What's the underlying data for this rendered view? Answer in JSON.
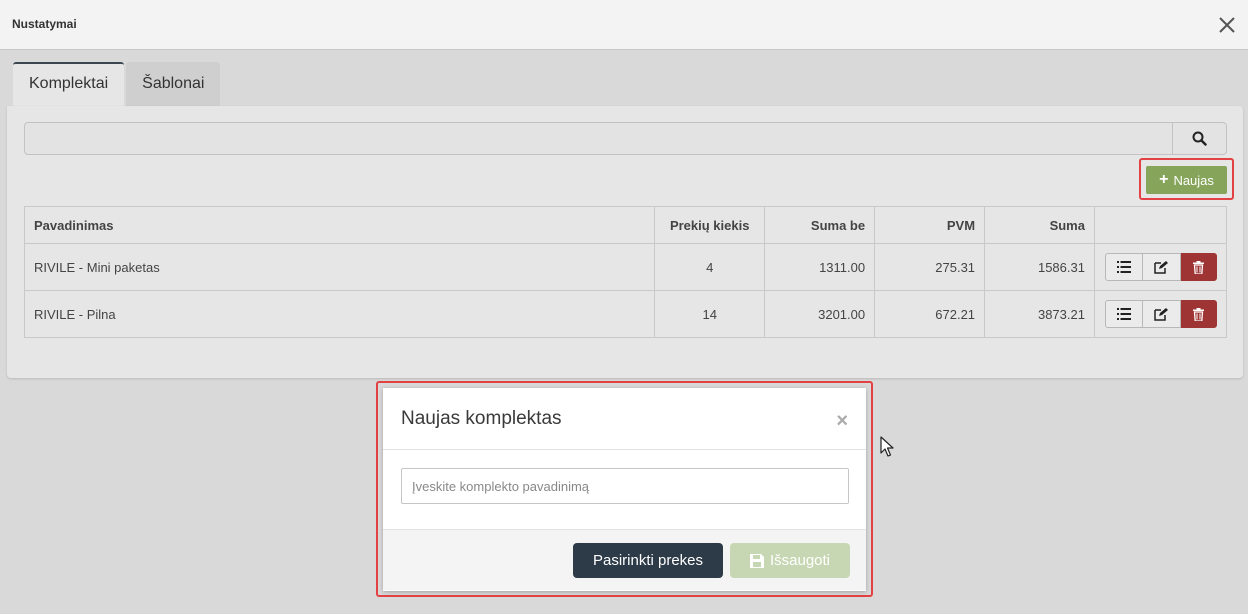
{
  "window": {
    "title": "Nustatymai",
    "close_icon": "close-icon"
  },
  "tabs": [
    {
      "label": "Komplektai",
      "active": true
    },
    {
      "label": "Šablonai",
      "active": false
    }
  ],
  "search": {
    "value": "",
    "placeholder": "",
    "icon": "search-icon"
  },
  "new_button": {
    "label": "Naujas",
    "icon": "plus-icon",
    "color": "#86a55b"
  },
  "table": {
    "headers": [
      "Pavadinimas",
      "Prekių kiekis",
      "Suma be",
      "PVM",
      "Suma",
      ""
    ],
    "rows": [
      {
        "name": "RIVILE - Mini paketas",
        "qty": "4",
        "sum_without": "1311.00",
        "vat": "275.31",
        "sum": "1586.31"
      },
      {
        "name": "RIVILE - Pilna",
        "qty": "14",
        "sum_without": "3201.00",
        "vat": "672.21",
        "sum": "3873.21"
      }
    ],
    "row_actions": [
      "list-icon",
      "edit-icon",
      "trash-icon"
    ]
  },
  "modal": {
    "title": "Naujas komplektas",
    "close_glyph": "×",
    "input_value": "",
    "input_placeholder": "Įveskite komplekto pavadinimą",
    "choose_label": "Pasirinkti prekes",
    "save_label": "Išsaugoti",
    "save_icon": "floppy-disk-icon"
  },
  "colors": {
    "highlight": "#e34244",
    "delete": "#9f3434",
    "primary_dark": "#2d3a47",
    "save_disabled": "#c8d7b3"
  }
}
